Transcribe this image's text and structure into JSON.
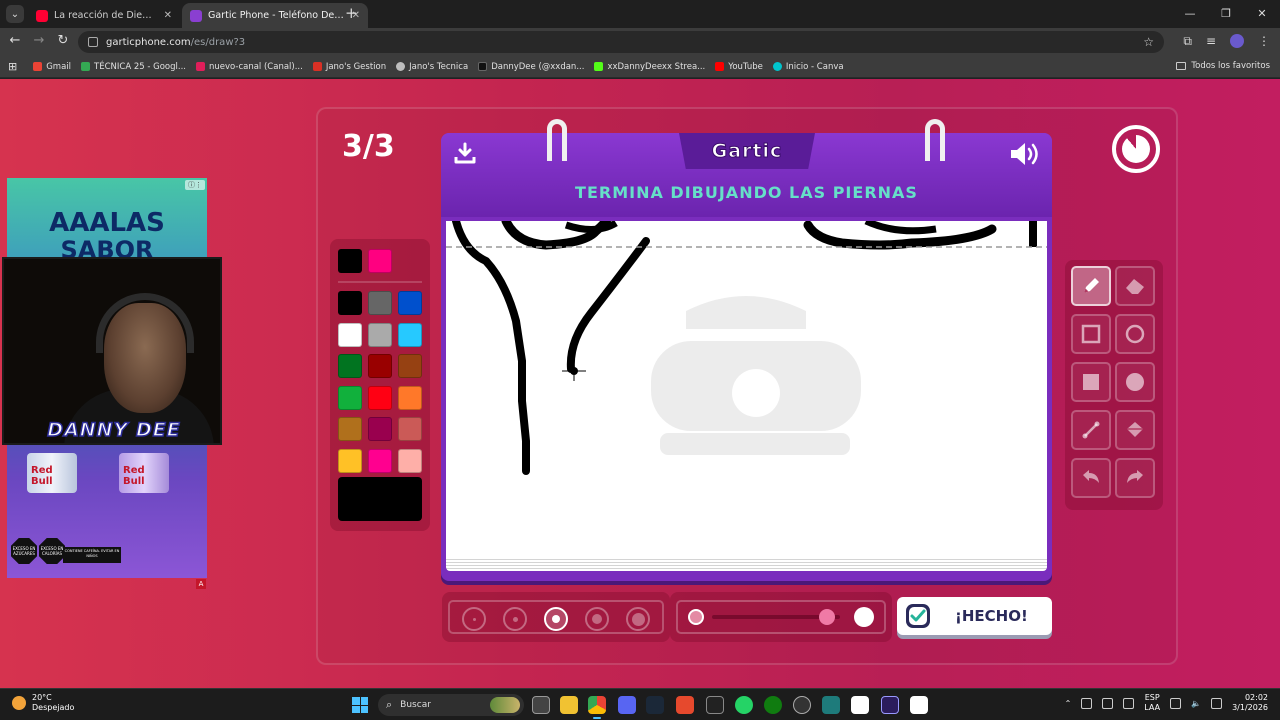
{
  "browser": {
    "tabs": [
      {
        "title": "La reacción de Dieguito Fernández",
        "favicon_color": "#ff0033"
      },
      {
        "title": "Gartic Phone - Teléfono Descomponido",
        "favicon_color": "#8a3fd1"
      }
    ],
    "url_host": "garticphone.com",
    "url_path": "/es/draw?3",
    "bookmarks": [
      {
        "label": "Gmail",
        "color": "#ea4335"
      },
      {
        "label": "TÉCNICA 25 - Googl...",
        "color": "#34a853"
      },
      {
        "label": "nuevo-canal (Canal)...",
        "color": "#e01e5a"
      },
      {
        "label": "Jano's Gestion",
        "color": "#d93025"
      },
      {
        "label": "Jano's Tecnica",
        "color": "#bdbdbd"
      },
      {
        "label": "DannyDee (@xxdan...",
        "color": "#111111"
      },
      {
        "label": "xxDannyDeexx Strea...",
        "color": "#53fc18"
      },
      {
        "label": "YouTube",
        "color": "#ff0000"
      },
      {
        "label": "Inicio - Canva",
        "color": "#00c4cc"
      }
    ],
    "all_bookmarks": "Todos los favoritos"
  },
  "game": {
    "round": "3/3",
    "logo": "Gartic",
    "prompt": "TERMINA DIBUJANDO LAS PIERNAS",
    "done_label": "¡HECHO!",
    "opacity_level": 0.9,
    "selected_size_index": 2,
    "active_tool": "pencil",
    "current_color": "#000000",
    "palette": [
      "#000000",
      "#ff0080",
      "#000000",
      "#666666",
      "#0050cd",
      "#ffffff",
      "#aaaaaa",
      "#26c9ff",
      "#017420",
      "#990000",
      "#964112",
      "#11b03c",
      "#ff0013",
      "#ff7829",
      "#b0701c",
      "#99004e",
      "#cb5a57",
      "#ffc126",
      "#ff008f",
      "#feafa8"
    ]
  },
  "ad": {
    "line1": "AAALAS",
    "line2": "SABOR POMELO",
    "can_brand": "Red Bull",
    "seal1": "EXCESO EN AZÚCARES",
    "seal2": "EXCESO EN CALORÍAS",
    "note": "CONTIENE CAFEÍNA. EVITAR EN NIÑOS"
  },
  "webcam": {
    "label": "DANNY DEE"
  },
  "taskbar": {
    "temp": "20°C",
    "condition": "Despejado",
    "search_placeholder": "Buscar",
    "lang1": "ESP",
    "lang2": "LAA",
    "time": "02:02",
    "date": "3/1/2026"
  }
}
